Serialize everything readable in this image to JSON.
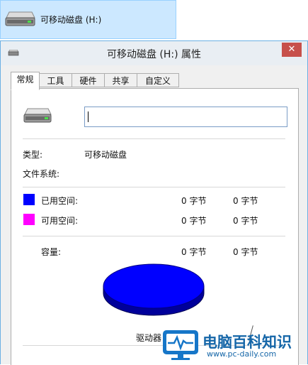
{
  "explorer": {
    "drive_label": "可移动磁盘 (H:)"
  },
  "dialog": {
    "title": "可移动磁盘 (H:) 属性",
    "close_glyph": "✕",
    "tabs": [
      {
        "label": "常规",
        "active": true
      },
      {
        "label": "工具",
        "active": false
      },
      {
        "label": "硬件",
        "active": false
      },
      {
        "label": "共享",
        "active": false
      },
      {
        "label": "自定义",
        "active": false
      }
    ],
    "general": {
      "name_value": "",
      "type_label": "类型:",
      "type_value": "可移动磁盘",
      "fs_label": "文件系统:",
      "fs_value": "",
      "used": {
        "label": "已用空间:",
        "bytes": "0 字节",
        "size": "0 字节",
        "color": "#0000ff"
      },
      "free": {
        "label": "可用空间:",
        "bytes": "0 字节",
        "size": "0 字节",
        "color": "#ff00ff"
      },
      "capacity": {
        "label": "容量:",
        "bytes": "0 字节",
        "size": "0 字节"
      },
      "pie_color": "#0000ff",
      "drive_caption": "驱动器"
    }
  },
  "watermark": {
    "text": "电脑百科知识",
    "url": "www.pc-daily.com"
  },
  "icons": [
    "removable-drive-icon",
    "drive-title-icon",
    "close-icon",
    "monitor-logo-icon"
  ]
}
